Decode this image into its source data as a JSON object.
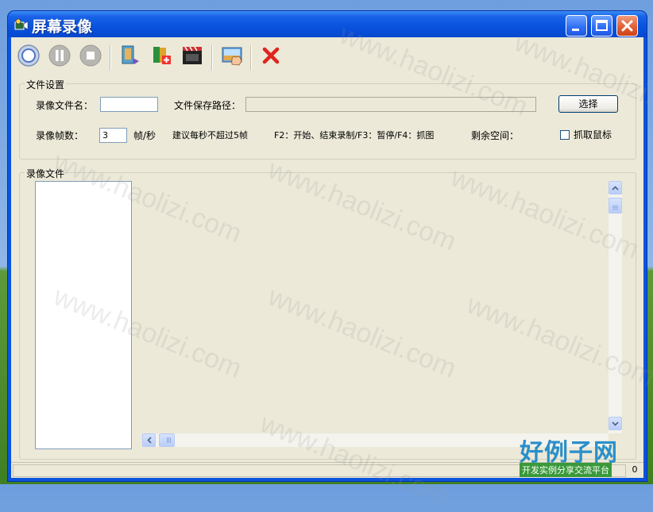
{
  "window": {
    "title": "屏幕录像"
  },
  "toolbar": {
    "items": [
      {
        "name": "record-button",
        "icon": "record-icon"
      },
      {
        "name": "pause-button",
        "icon": "pause-icon"
      },
      {
        "name": "stop-button",
        "icon": "stop-icon"
      },
      {
        "name": "open-file-button",
        "icon": "open-file-icon"
      },
      {
        "name": "add-file-button",
        "icon": "add-file-icon"
      },
      {
        "name": "play-video-button",
        "icon": "film-clapper-icon"
      },
      {
        "name": "capture-region-button",
        "icon": "hand-image-icon"
      },
      {
        "name": "exit-button",
        "icon": "red-x-icon"
      }
    ]
  },
  "file_settings": {
    "group_title": "文件设置",
    "filename_label": "录像文件名：",
    "filename_value": "",
    "save_path_label": "文件保存路径：",
    "save_path_value": "",
    "browse_label": "选择",
    "fps_label": "录像帧数：",
    "fps_value": "3",
    "fps_unit": "帧/秒",
    "fps_hint": "建议每秒不超过5帧",
    "hotkeys": "F2：开始、结束录制/F3：暂停/F4：抓图",
    "free_space_label": "剩余空间：",
    "capture_mouse_label": "抓取鼠标",
    "capture_mouse_checked": false
  },
  "record_files": {
    "group_title": "录像文件",
    "items": []
  },
  "statusbar": {
    "count": "0"
  },
  "watermark": {
    "text": "www.haolizi.com"
  },
  "brand": {
    "title": "好例子网",
    "subtitle": "开发实例分享交流平台"
  },
  "colors": {
    "titlebar": "#0a54de",
    "client": "#ece9d8",
    "close_button": "#e25b2f"
  }
}
